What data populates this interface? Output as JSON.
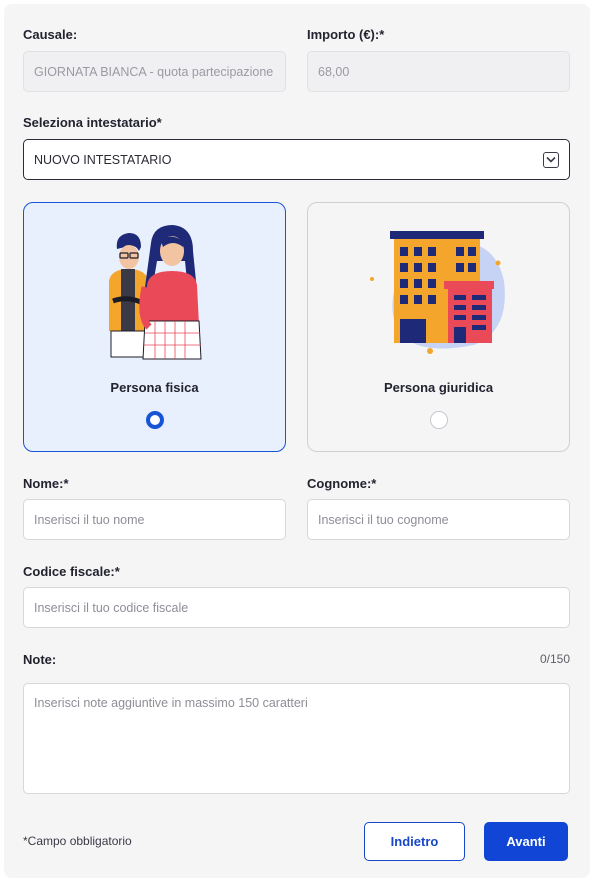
{
  "causale": {
    "label": "Causale:",
    "value": "GIORNATA BIANCA - quota partecipazione"
  },
  "importo": {
    "label": "Importo (€):*",
    "value": "68,00"
  },
  "intestatario": {
    "label": "Seleziona intestatario*",
    "selected": "NUOVO INTESTATARIO"
  },
  "cards": [
    {
      "title": "Persona fisica",
      "selected": true
    },
    {
      "title": "Persona giuridica",
      "selected": false
    }
  ],
  "nome": {
    "label": "Nome:*",
    "placeholder": "Inserisci il tuo nome"
  },
  "cognome": {
    "label": "Cognome:*",
    "placeholder": "Inserisci il tuo cognome"
  },
  "codice_fiscale": {
    "label": "Codice fiscale:*",
    "placeholder": "Inserisci il tuo codice fiscale"
  },
  "note": {
    "label": "Note:",
    "counter": "0/150",
    "placeholder": "Inserisci note aggiuntive in massimo 150 caratteri"
  },
  "footer": {
    "required_note": "*Campo obbligatorio",
    "back_label": "Indietro",
    "next_label": "Avanti"
  },
  "colors": {
    "primary": "#1145d6",
    "selected_card_bg": "#e9f0fd"
  }
}
